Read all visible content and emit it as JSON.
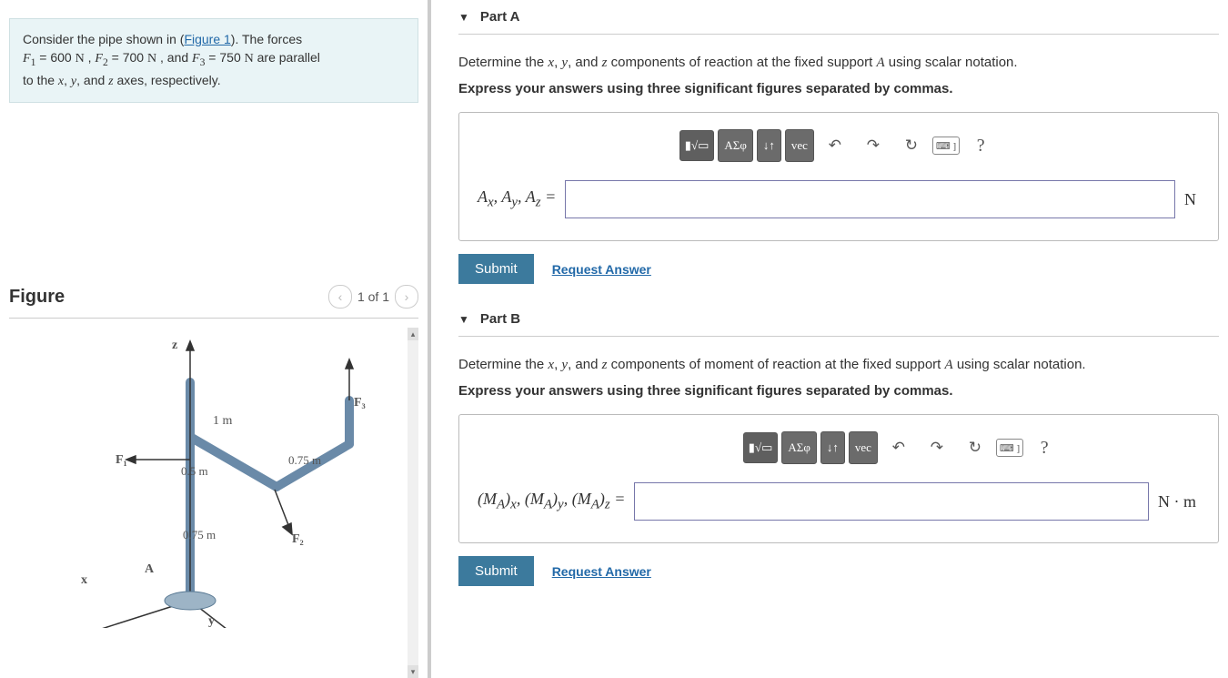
{
  "problem": {
    "text_before_link": "Consider the pipe shown in (",
    "link_text": "Figure 1",
    "text_after_link": "). The forces ",
    "forces_line_html": "F₁ = 600 N , F₂ = 700 N , and F₃ = 750 N are parallel",
    "last_line": "to the x, y, and z axes, respectively."
  },
  "figure": {
    "title": "Figure",
    "pager_text": "1 of 1",
    "labels": {
      "z": "z",
      "x": "x",
      "y": "y",
      "A": "A",
      "F1": "F₁",
      "F2": "F₂",
      "F3": "F₃",
      "d1": "1 m",
      "d2": "0.5 m",
      "d3": "0.75 m",
      "d4": "0.75 m"
    }
  },
  "partA": {
    "title": "Part A",
    "instruction": "Determine the x, y, and z components of reaction at the fixed support A using scalar notation.",
    "instruction_bold": "Express your answers using three significant figures separated by commas.",
    "answer_label": "Aₓ, Aᵧ, A_z =",
    "unit": "N",
    "help_char": "?"
  },
  "partB": {
    "title": "Part B",
    "instruction": "Determine the x, y, and z components of moment of reaction at the fixed support A using scalar notation.",
    "instruction_bold": "Express your answers using three significant figures separated by commas.",
    "answer_label": "(M_A)ₓ, (M_A)ᵧ, (M_A)_z =",
    "unit": "N · m",
    "help_char": "?"
  },
  "toolbar": {
    "templates": "▮√▭",
    "greek": "ΑΣφ",
    "subscript": "↓↑",
    "vec": "vec",
    "undo": "↶",
    "redo": "↷",
    "reset": "↻",
    "keyboard": "⌨ ]"
  },
  "buttons": {
    "submit": "Submit",
    "request_answer": "Request Answer"
  }
}
